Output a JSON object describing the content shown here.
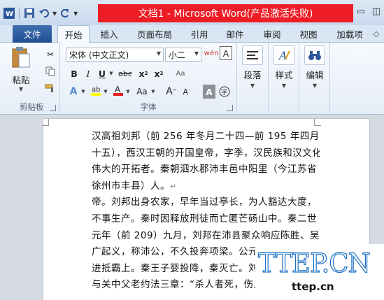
{
  "window": {
    "title": "文档1 - Microsoft Word(产品激活失败)",
    "title_bg": "#ee1c24"
  },
  "qat": {
    "items": [
      "word-logo-icon",
      "save-icon",
      "undo-icon",
      "redo-icon"
    ]
  },
  "tabs": [
    {
      "label": "文件"
    },
    {
      "label": "开始"
    },
    {
      "label": "插入"
    },
    {
      "label": "页面布局"
    },
    {
      "label": "引用"
    },
    {
      "label": "邮件"
    },
    {
      "label": "审阅"
    },
    {
      "label": "视图"
    },
    {
      "label": "加载项"
    }
  ],
  "ribbon": {
    "clipboard": {
      "paste_label": "粘贴",
      "group_label": "剪贴板"
    },
    "font": {
      "font_name": "宋体 (中文正文)",
      "font_size": "小二",
      "group_label": "字体",
      "bold": "B",
      "italic": "I",
      "underline": "U",
      "strike": "abc",
      "subscript": "x",
      "superscript": "x",
      "size_inc": "A",
      "size_dec": "A",
      "change_case": "Aa"
    },
    "paragraph": {
      "label": "段落"
    },
    "styles": {
      "label": "样式"
    },
    "editing": {
      "label": "编辑"
    }
  },
  "document": {
    "lines": [
      "汉高祖刘邦（前 256 年冬月二十四—前 195 年四月二",
      "十五），西汉王朝的开国皇帝，字季，汉民族和汉文化",
      "伟大的开拓者。秦朝泗水郡沛丰邑中阳里（今江苏省",
      "徐州市丰县）人。",
      "帝。刘邦出身农家，早年当过亭长，为人豁达大度，",
      "不事生产。秦时因释放刑徒而亡匿芒砀山中。秦二世",
      "元年（前 209）九月，刘邦在沛县聚众响应陈胜、吴",
      "广起义，称沛公，不久投奔项梁。公元",
      "进抵霸上。秦王子婴投降，秦灭亡。刘",
      "与关中父老约法三章：“杀人者死，伤人"
    ]
  },
  "watermark": {
    "big": "TTEP.CN",
    "small": "ttep.cn"
  }
}
